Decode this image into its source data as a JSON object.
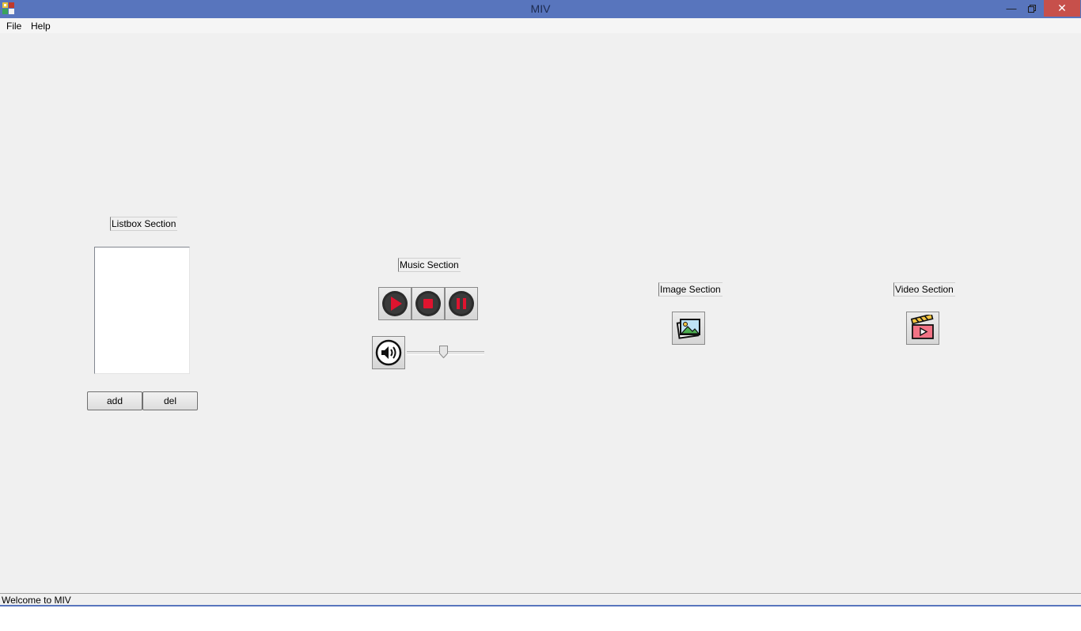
{
  "window": {
    "title": "MIV",
    "minimize_icon": "minimize-icon",
    "restore_icon": "restore-icon",
    "close_icon": "close-icon"
  },
  "menu": [
    {
      "label": "File"
    },
    {
      "label": "Help"
    }
  ],
  "listbox_section": {
    "label": "Listbox Section",
    "items": [],
    "add_label": "add",
    "del_label": "del"
  },
  "music_section": {
    "label": "Music Section",
    "buttons": [
      "play-icon",
      "stop-icon",
      "pause-icon"
    ],
    "volume_icon": "speaker-icon",
    "volume_level": 0.47
  },
  "image_section": {
    "label": "Image Section",
    "button_icon": "image-icon"
  },
  "video_section": {
    "label": "Video Section",
    "button_icon": "video-clapper-icon"
  },
  "status": {
    "text": "Welcome to MIV"
  },
  "colors": {
    "titlebar": "#5875bd",
    "close": "#c7504b",
    "media_red": "#e0142f",
    "background": "#f0f0f0"
  }
}
